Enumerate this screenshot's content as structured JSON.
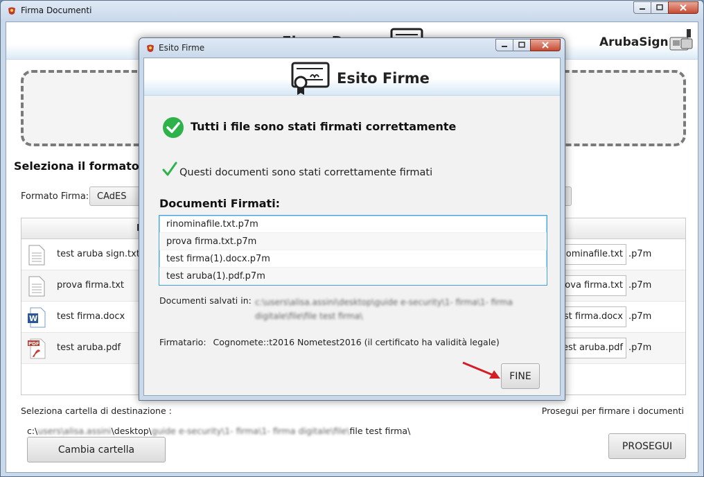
{
  "window": {
    "title": "Firma Documenti",
    "banner_title": "Firma Documenti",
    "brand": "ArubaSign"
  },
  "main": {
    "section_title": "Seleziona il formato d",
    "format_label": "Formato Firma:",
    "format_value": "CAdES",
    "table_header_fragment": "D",
    "files": [
      {
        "name": "test aruba sign.txt",
        "output": "ominafile.txt",
        "ext": ".p7m",
        "icon": "text-file-icon"
      },
      {
        "name": "prova firma.txt",
        "output": "prova firma.txt",
        "ext": ".p7m",
        "icon": "text-file-icon"
      },
      {
        "name": "test firma.docx",
        "output": "test firma.docx",
        "ext": ".p7m",
        "icon": "word-file-icon"
      },
      {
        "name": "test aruba.pdf",
        "output": "test aruba.pdf",
        "ext": ".p7m",
        "icon": "pdf-file-icon"
      }
    ],
    "dest_label": "Seleziona cartella di destinazione :",
    "proceed_hint": "Prosegui per firmare i documenti",
    "path_prefix": "c:\\",
    "path_blur_1": "users\\alisa.assini",
    "path_mid": "\\desktop\\",
    "path_blur_2": "guide e-security\\1- firma\\1- firma digitale\\file\\",
    "path_suffix": "file test firma\\",
    "change_button": "Cambia cartella",
    "proceed_button": "PROSEGUI"
  },
  "dialog": {
    "title": "Esito Firme",
    "banner_title": "Esito Firme",
    "success_message": "Tutti i file sono stati firmati correttamente",
    "check_message": "Questi documenti sono stati correttamente firmati",
    "docs_title": "Documenti Firmati:",
    "docs": [
      "rinominafile.txt.p7m",
      "prova firma.txt.p7m",
      "test firma(1).docx.p7m",
      "test aruba(1).pdf.p7m"
    ],
    "saved_label": "Documenti salvati in:",
    "saved_path": "c:\\users\\alisa.assini\\desktop\\guide e-security\\1- firma\\1- firma digitale\\file\\file test firma\\",
    "signer_label": "Firmatario:",
    "signer_value": "Cognomete::t2016 Nometest2016 (il certificato ha validità legale)",
    "fine_button": "FINE"
  },
  "colors": {
    "success_green": "#2eb34a",
    "accent_blue": "#45a3dc",
    "arrow_red": "#d21f26"
  }
}
